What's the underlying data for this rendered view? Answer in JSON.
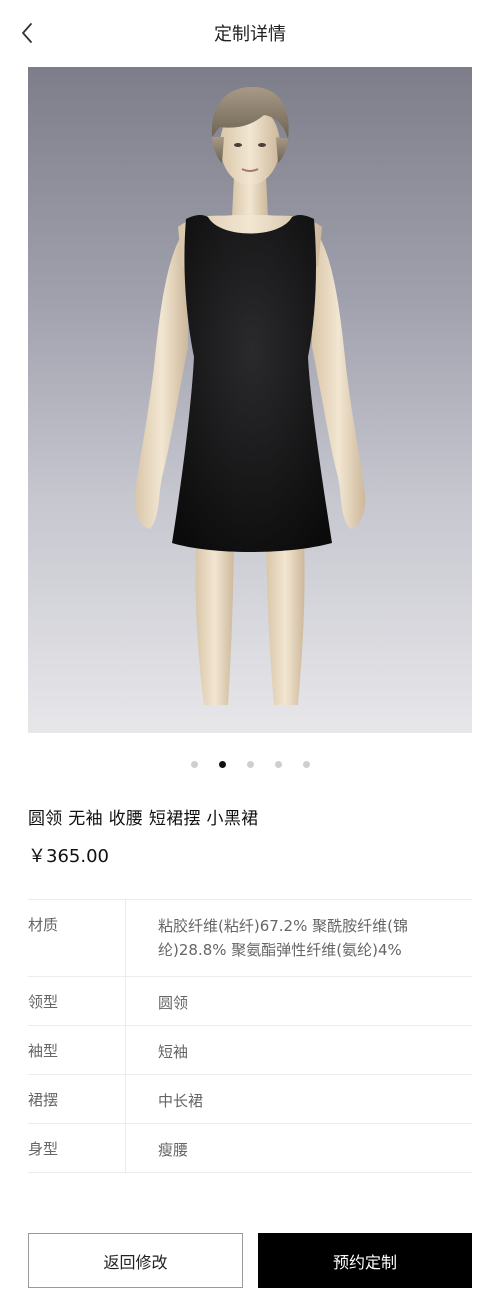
{
  "nav": {
    "title": "定制详情",
    "back_icon": "chevron-left-icon"
  },
  "carousel": {
    "total": 5,
    "active_index": 1
  },
  "product": {
    "name": "圆领 无袖 收腰 短裙摆 小黑裙",
    "price": "￥365.00"
  },
  "specs": [
    {
      "label": "材质",
      "value": "粘胶纤维(粘纤)67.2%  聚酰胺纤维(锦纶)28.8%  聚氨酯弹性纤维(氨纶)4%"
    },
    {
      "label": "领型",
      "value": "圆领"
    },
    {
      "label": "袖型",
      "value": "短袖"
    },
    {
      "label": "裙摆",
      "value": "中长裙"
    },
    {
      "label": "身型",
      "value": "瘦腰"
    }
  ],
  "actions": {
    "back_label": "返回修改",
    "book_label": "预约定制"
  },
  "colors": {
    "primary_button": "#000000",
    "active_dot": "#111111",
    "inactive_dot": "#cfcfcf"
  }
}
